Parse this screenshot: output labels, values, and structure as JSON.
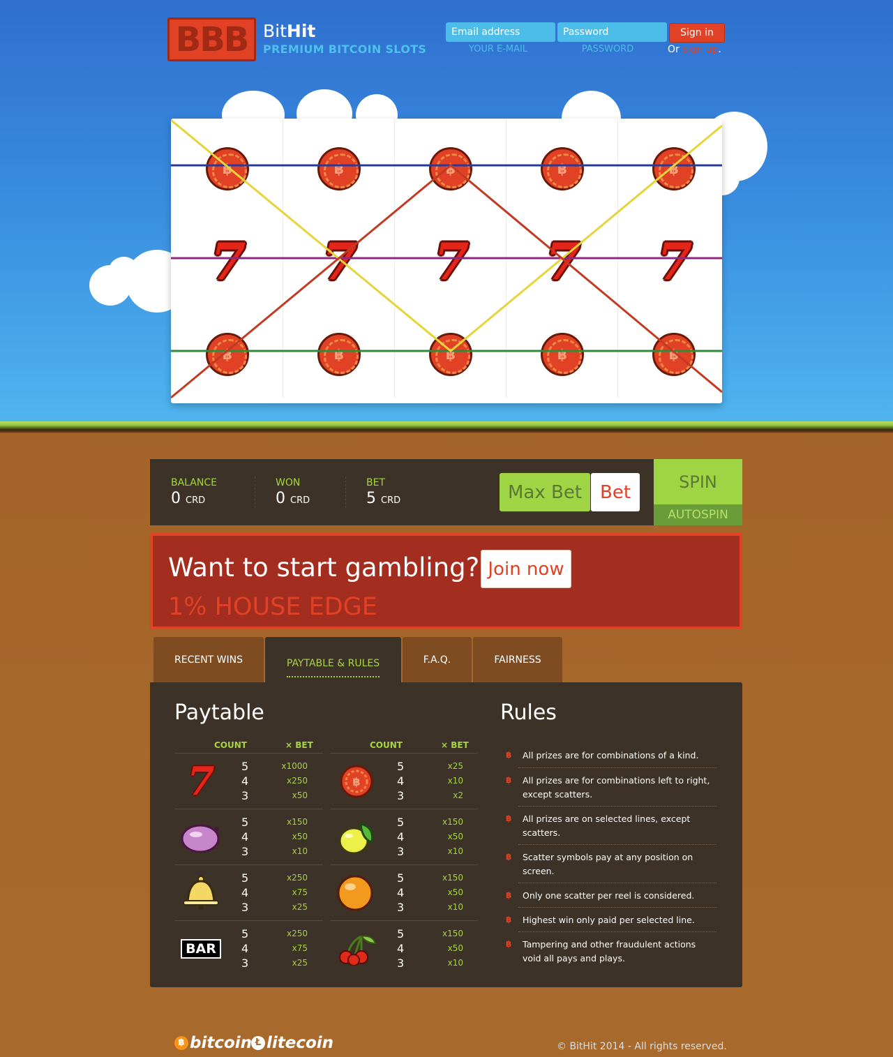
{
  "header": {
    "logo_text": "BBB",
    "brand_light": "Bit",
    "brand_bold": "Hit",
    "tagline": "PREMIUM BITCOIN SLOTS",
    "email_placeholder": "Email address",
    "password_placeholder": "Password",
    "email_label": "YOUR E-MAIL",
    "password_label": "PASSWORD",
    "signin_label": "Sign in",
    "or_text": "Or",
    "signup_link": "sign up",
    "signup_suffix": "."
  },
  "slot": {
    "bitcoin_glyph": "฿",
    "seven_glyph": "7",
    "paylines": [
      {
        "color": "#2a3a9c"
      },
      {
        "color": "#8e2a7e"
      },
      {
        "color": "#2f8a3a"
      },
      {
        "color": "#e5d43a"
      },
      {
        "color": "#c33a22"
      }
    ]
  },
  "controls": {
    "balance_label": "BALANCE",
    "balance_value": "0",
    "won_label": "WON",
    "won_value": "0",
    "bet_label": "BET",
    "bet_value": "5",
    "unit": "CRD",
    "maxbet_label": "Max Bet",
    "bet_button_label": "Bet",
    "spin_label": "SPIN",
    "autospin_label": "AUTOSPIN"
  },
  "banner": {
    "headline": "Want to start gambling?",
    "join_label": "Join now",
    "edge_text": "1% HOUSE EDGE"
  },
  "tabs": [
    {
      "label": "RECENT WINS"
    },
    {
      "label": "PAYTABLE & RULES"
    },
    {
      "label": "F.A.Q."
    },
    {
      "label": "FAIRNESS"
    }
  ],
  "paytable": {
    "title": "Paytable",
    "count_header": "COUNT",
    "bet_header": "× BET",
    "counts": [
      "5",
      "4",
      "3"
    ],
    "left": [
      {
        "symbol": "seven",
        "mults": [
          "x1000",
          "x250",
          "x50"
        ]
      },
      {
        "symbol": "plum",
        "mults": [
          "x150",
          "x50",
          "x10"
        ]
      },
      {
        "symbol": "bell",
        "mults": [
          "x250",
          "x75",
          "x25"
        ]
      },
      {
        "symbol": "bar",
        "mults": [
          "x250",
          "x75",
          "x25"
        ]
      }
    ],
    "right": [
      {
        "symbol": "bitcoin-chip",
        "mults": [
          "x25",
          "x10",
          "x2"
        ]
      },
      {
        "symbol": "lemon",
        "mults": [
          "x150",
          "x50",
          "x10"
        ]
      },
      {
        "symbol": "orange",
        "mults": [
          "x150",
          "x50",
          "x10"
        ]
      },
      {
        "symbol": "cherries",
        "mults": [
          "x150",
          "x50",
          "x10"
        ]
      }
    ],
    "bar_text": "BAR"
  },
  "rules": {
    "title": "Rules",
    "bullet": "฿",
    "items": [
      "All prizes are for combinations of a kind.",
      "All prizes are for combinations left to right, except scatters.",
      "All prizes are on selected lines, except scatters.",
      "Scatter symbols pay at any position on screen.",
      "Only one scatter per reel is considered.",
      "Highest win only paid per selected line.",
      "Tampering and other fraudulent actions void all pays and plays."
    ]
  },
  "footer": {
    "bitcoin_label": "bitcoin",
    "bitcoin_glyph": "฿",
    "litecoin_label": "litecoin",
    "litecoin_glyph": "Ł",
    "copyright": "© BitHit 2014 - All rights reserved."
  }
}
